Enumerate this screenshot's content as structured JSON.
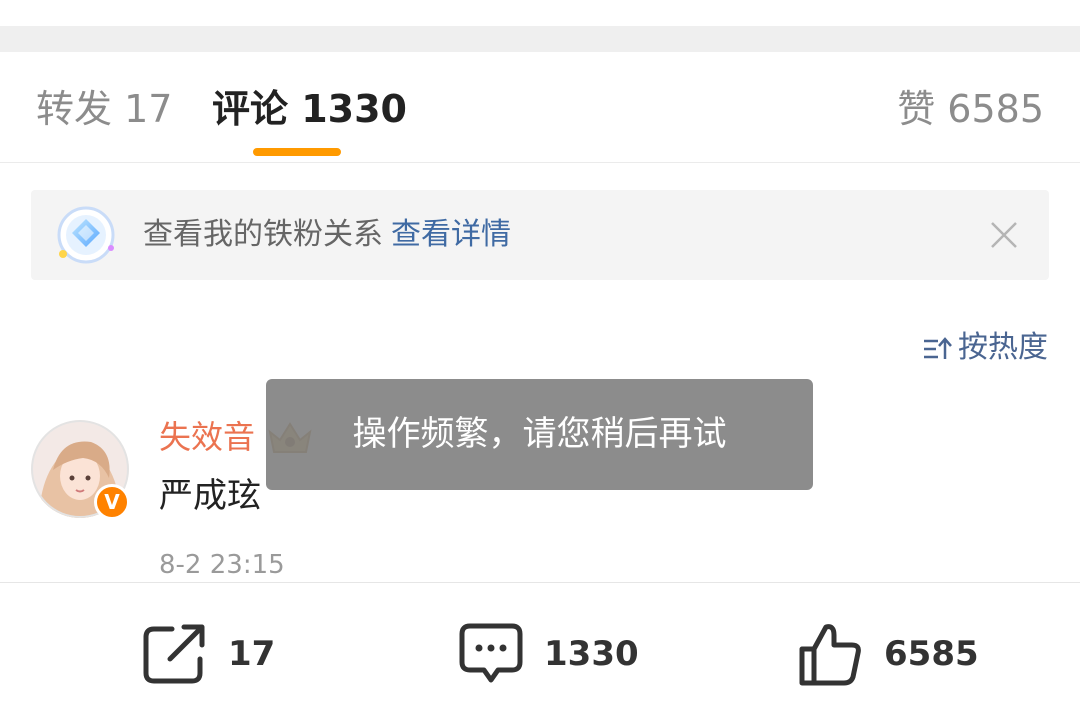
{
  "tabs": {
    "repost": "转发 17",
    "comments": "评论 1330",
    "likes": "赞 6585"
  },
  "fan_banner": {
    "text": "查看我的铁粉关系",
    "link": "查看详情",
    "icon": "diamond-badge-icon"
  },
  "sort": {
    "label": "按热度",
    "icon": "sort-icon"
  },
  "comment": {
    "username": "失效音",
    "content": "严成玹",
    "time": "8-2 23:15",
    "verified_badge": "V"
  },
  "toast": {
    "message": "操作频繁，请您稍后再试"
  },
  "bottom_bar": {
    "repost_count": "17",
    "comment_count": "1330",
    "like_count": "6585"
  },
  "colors": {
    "accent": "#ff9a00",
    "link": "#3f6aa3",
    "username": "#eb7350",
    "verified": "#ff8200"
  }
}
